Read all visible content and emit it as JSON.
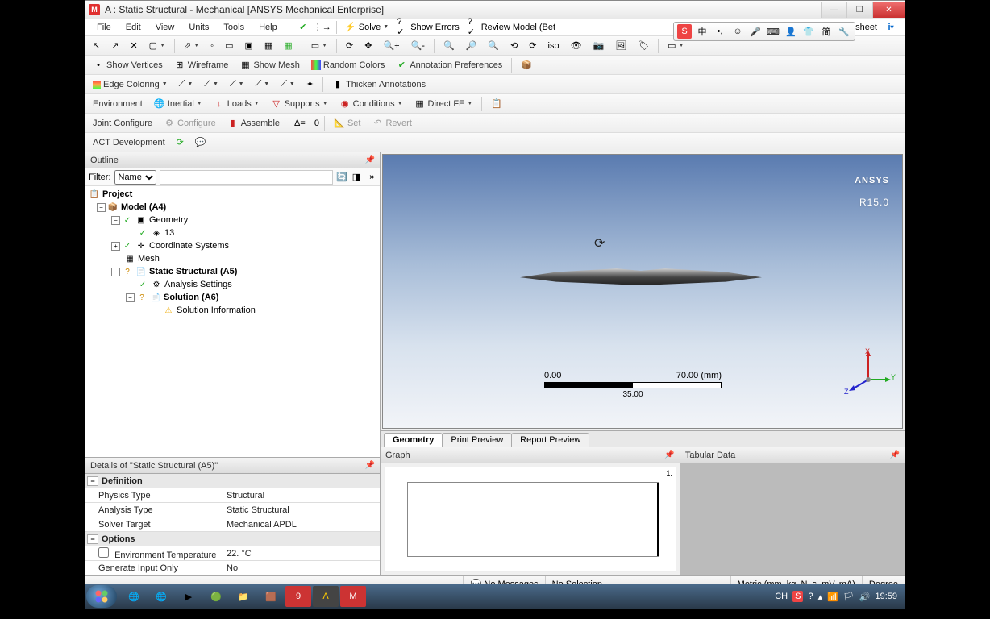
{
  "window": {
    "title": "A : Static Structural - Mechanical [ANSYS Mechanical Enterprise]"
  },
  "menu": {
    "file": "File",
    "edit": "Edit",
    "view": "View",
    "units": "Units",
    "tools": "Tools",
    "help": "Help",
    "solve": "Solve",
    "show_errors": "Show Errors",
    "review_model": "Review Model (Bet",
    "worksheet": "orksheet"
  },
  "ime": {
    "lang": "中",
    "punct": "•,",
    "keyboard": "⌨",
    "mic": "🎤",
    "more": "简",
    "s": "S"
  },
  "tb2": {
    "show_vertices": "Show Vertices",
    "wireframe": "Wireframe",
    "show_mesh": "Show Mesh",
    "random_colors": "Random Colors",
    "annotation_prefs": "Annotation Preferences"
  },
  "tb3": {
    "edge_coloring": "Edge Coloring",
    "thicken": "Thicken Annotations"
  },
  "tb4": {
    "environment": "Environment",
    "inertial": "Inertial",
    "loads": "Loads",
    "supports": "Supports",
    "conditions": "Conditions",
    "direct_fe": "Direct FE"
  },
  "tb5": {
    "joint": "Joint Configure",
    "configure": "Configure",
    "assemble": "Assemble",
    "delta": "Δ=",
    "delta_val": "0",
    "set": "Set",
    "revert": "Revert"
  },
  "tb6": {
    "act": "ACT Development"
  },
  "outline": {
    "title": "Outline",
    "filter_label": "Filter:",
    "filter_value": "Name",
    "tree": {
      "project": "Project",
      "model": "Model (A4)",
      "geometry": "Geometry",
      "geom_item": "13",
      "coord": "Coordinate Systems",
      "mesh": "Mesh",
      "static": "Static Structural (A5)",
      "analysis": "Analysis Settings",
      "solution": "Solution (A6)",
      "solinfo": "Solution Information"
    }
  },
  "details": {
    "title": "Details of \"Static Structural (A5)\"",
    "definition": "Definition",
    "physics_k": "Physics Type",
    "physics_v": "Structural",
    "analysis_k": "Analysis Type",
    "analysis_v": "Static Structural",
    "solver_k": "Solver Target",
    "solver_v": "Mechanical APDL",
    "options": "Options",
    "envtemp_k": "Environment Temperature",
    "envtemp_v": "22. °C",
    "geninput_k": "Generate Input Only",
    "geninput_v": "No"
  },
  "viewport": {
    "brand": "ANSYS",
    "version": "R15.0",
    "scale_min": "0.00",
    "scale_max": "70.00 (mm)",
    "scale_mid": "35.00",
    "axis_x": "X",
    "axis_y": "Y",
    "axis_z": "Z"
  },
  "viewtabs": {
    "geometry": "Geometry",
    "print": "Print Preview",
    "report": "Report Preview"
  },
  "graph": {
    "title": "Graph",
    "tick": "1."
  },
  "tabular": {
    "title": "Tabular Data"
  },
  "status": {
    "msgs": "No Messages",
    "sel": "No Selection",
    "units": "Metric (mm, kg, N, s, mV, mA)",
    "deg": "Degree"
  },
  "taskbar": {
    "lang": "CH",
    "clock": "19:59"
  }
}
